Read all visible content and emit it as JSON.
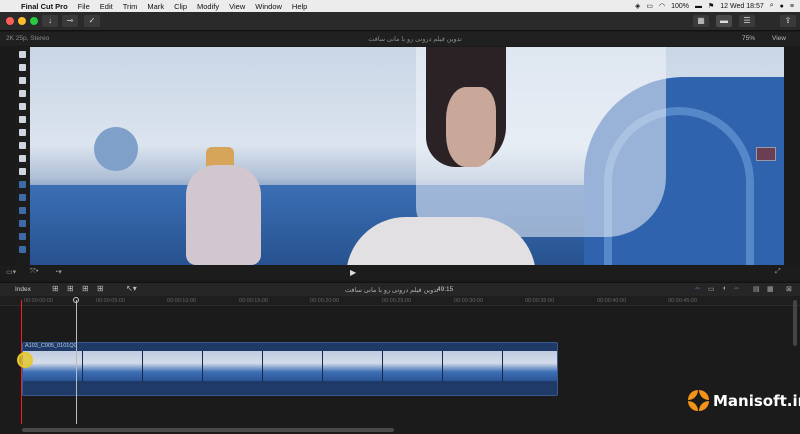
{
  "menubar": {
    "apple": "",
    "items": [
      "Final Cut Pro",
      "File",
      "Edit",
      "Trim",
      "Mark",
      "Clip",
      "Modify",
      "View",
      "Window",
      "Help"
    ],
    "battery": "100%",
    "clock": "12 Wed 18:57"
  },
  "viewer": {
    "format": "2K 25p, Stereo",
    "project_title": "تدوین فیلم درونی رو با مانی سافت",
    "zoom": "75%",
    "view_menu": "View"
  },
  "timeline": {
    "index_label": "Index",
    "project_title": "تدوین فیلم درونی رو با مانی سافت",
    "duration": "49:15",
    "clip_name": "A103_C005_0101Q0",
    "ruler": [
      "00:00:00:00",
      "00:00:05:00",
      "00:00:10:00",
      "00:00:15:00",
      "00:00:20:00",
      "00:00:25:00",
      "00:00:30:00",
      "00:00:35:00",
      "00:00:40:00",
      "00:00:45:00"
    ]
  },
  "watermark": {
    "text": "Manisoft.ir",
    "color": "#f39318"
  }
}
